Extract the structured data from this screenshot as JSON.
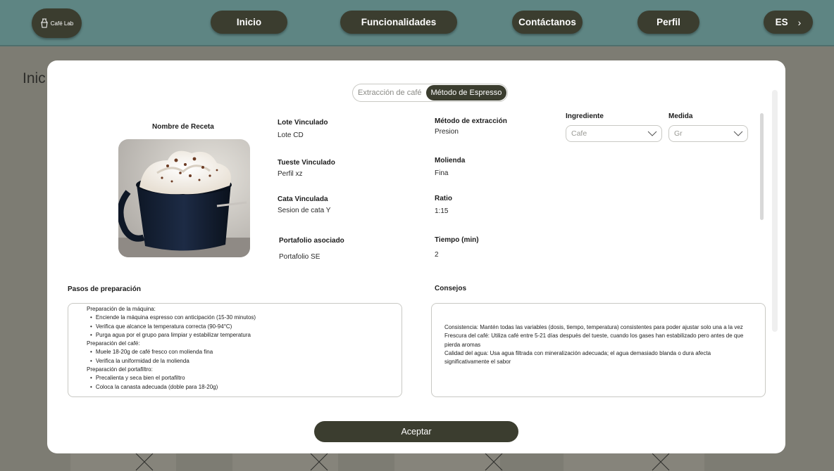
{
  "header": {
    "logo_text": "Café Lab",
    "nav": {
      "inicio": "Inicio",
      "funcionalidades": "Funcionalidades",
      "contactanos": "Contáctanos",
      "perfil": "Perfil"
    },
    "language": "ES"
  },
  "background": {
    "title": "Inic"
  },
  "modal": {
    "tabs": {
      "extraction": "Extracción de café",
      "espresso": "Método de Espresso"
    },
    "recipe_name_label": "Nombre de Receta",
    "fields": {
      "lote_label": "Lote Vinculado",
      "lote_value": "Lote CD",
      "tueste_label": "Tueste Vinculado",
      "tueste_value": "Perfil xz",
      "cata_label": "Cata Vinculada",
      "cata_value": "Sesion de cata Y",
      "portafolio_label": "Portafolio asociado",
      "portafolio_value": "Portafolio SE",
      "metodo_label": "Método de extracción",
      "metodo_value": "Presion",
      "molienda_label": "Molienda",
      "molienda_value": "Fina",
      "ratio_label": "Ratio",
      "ratio_value": "1:15",
      "tiempo_label": "Tiempo (min)",
      "tiempo_value": "2"
    },
    "ingredient": {
      "label": "Ingrediente",
      "value": "Cafe"
    },
    "measure": {
      "label": "Medida",
      "value": "Gr"
    },
    "steps": {
      "label": "Pasos de preparación",
      "groups": [
        {
          "title": "Preparación de la máquina:",
          "items": [
            "Enciende la máquina espresso con anticipación (15-30 minutos)",
            "Verifica que alcance la temperatura correcta (90-94°C)",
            "Purga agua por el grupo para limpiar y estabilizar temperatura"
          ]
        },
        {
          "title": "Preparación del café:",
          "items": [
            "Muele 18-20g de café fresco con molienda fina",
            "Verifica la uniformidad de la molienda"
          ]
        },
        {
          "title": "Preparación del portafiltro:",
          "items": [
            "Precalienta y seca bien el portafiltro",
            "Coloca la canasta adecuada (doble para 18-20g)"
          ]
        }
      ]
    },
    "tips": {
      "label": "Consejos",
      "items": [
        "Consistencia: Mantén todas las variables (dosis, tiempo, temperatura) consistentes para poder ajustar solo una a la vez",
        "Frescura del café: Utiliza café entre 5-21 días después del tueste, cuando los gases han estabilizado pero antes de que pierda aromas",
        "Calidad del agua: Usa agua filtrada con mineralización adecuada; el agua demasiado blanda o dura afecta significativamente el sabor"
      ]
    },
    "accept_label": "Aceptar"
  }
}
